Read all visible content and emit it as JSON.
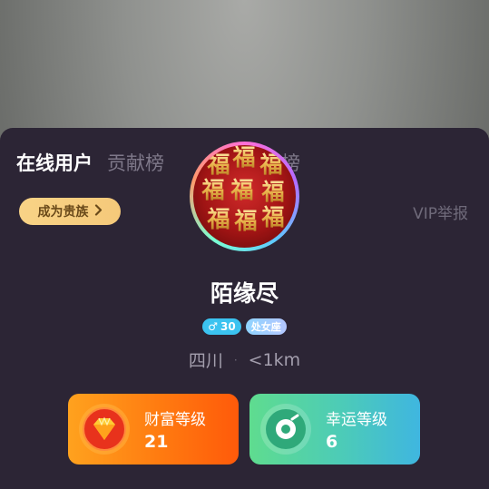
{
  "tabs": [
    {
      "label": "在线用户",
      "active": true
    },
    {
      "label": "贡献榜",
      "active": false
    },
    {
      "label": "献榜",
      "active": false
    }
  ],
  "noble_button": {
    "label": "成为贵族",
    "icon": "chevron-right-icon"
  },
  "report": {
    "label": "VIP举报"
  },
  "avatar": {
    "icon": "avatar-fu-image",
    "glyph": "福"
  },
  "user": {
    "name": "陌缘尽",
    "gender_symbol": "♂",
    "age": "30",
    "zodiac": "处女座",
    "region": "四川",
    "separator": "·",
    "distance": "<1km"
  },
  "cards": {
    "wealth": {
      "label": "财富等级",
      "value": "21",
      "color": "#ff7a10"
    },
    "luck": {
      "label": "幸运等级",
      "value": "6",
      "color": "#4ccbb8"
    }
  },
  "colors": {
    "sheet": "#2c2535",
    "accent_gold": "#f8d386"
  }
}
